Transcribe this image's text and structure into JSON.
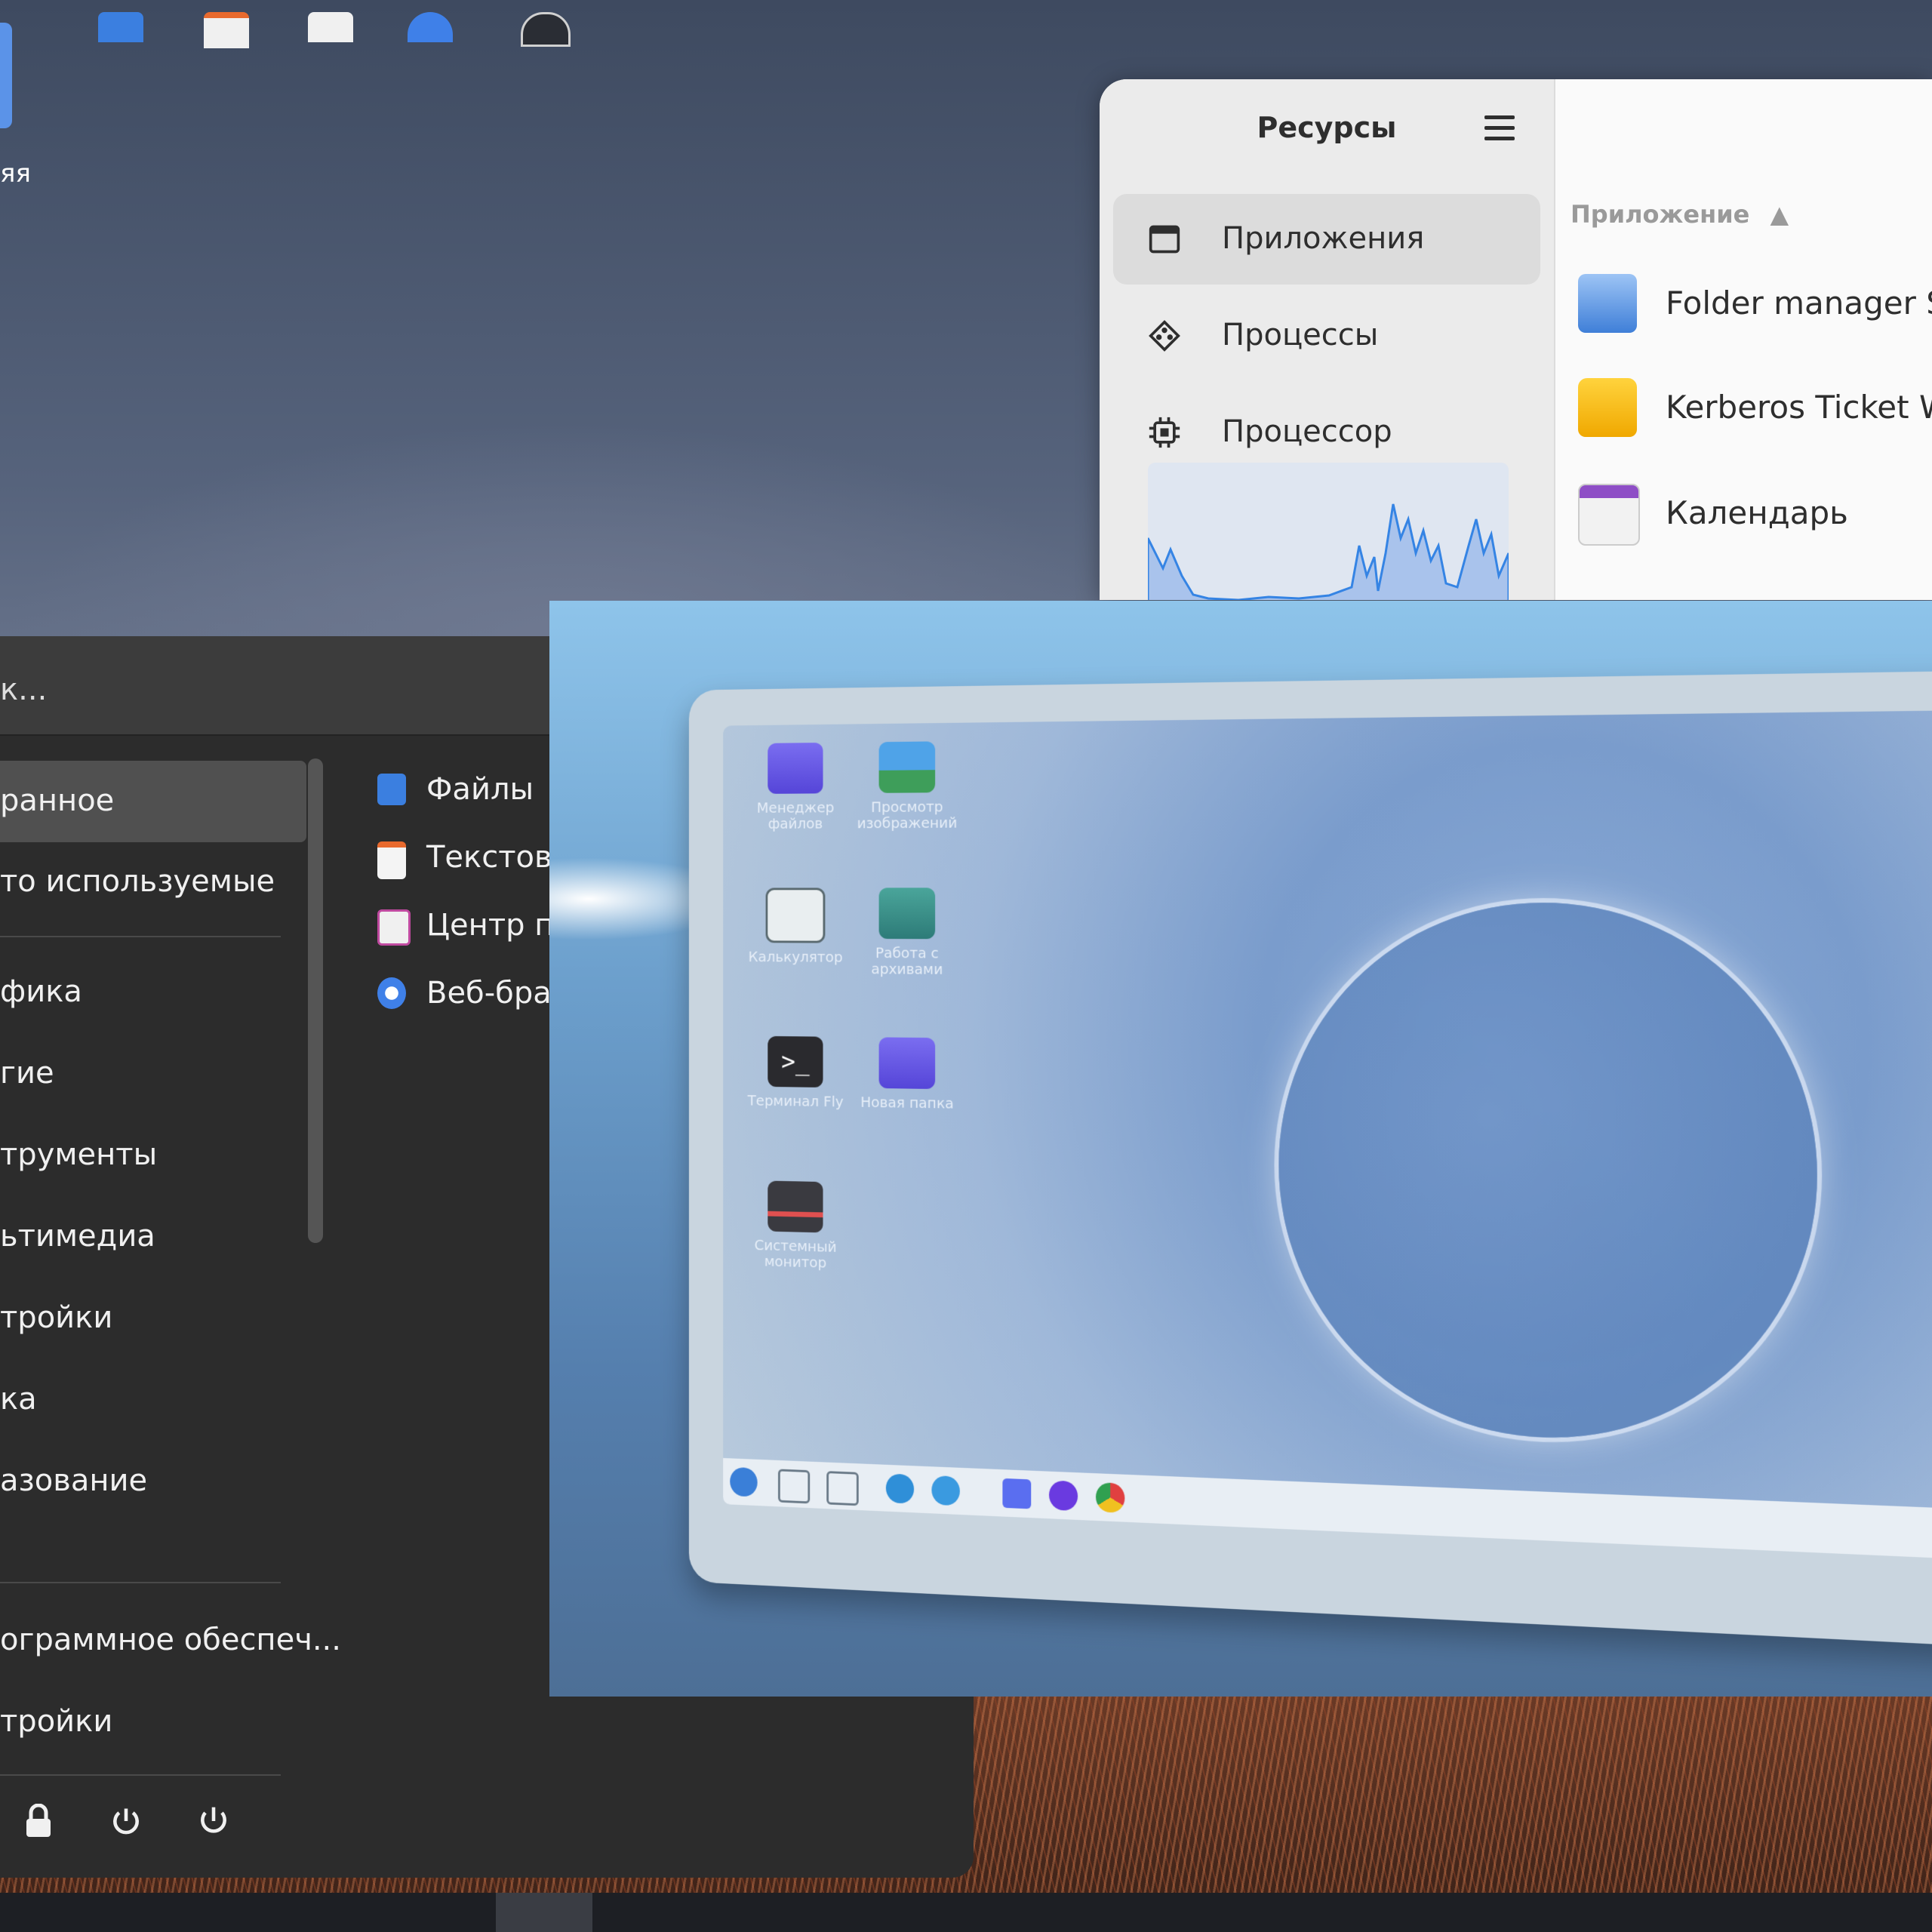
{
  "desktop": {
    "icon_label": "яя"
  },
  "resources": {
    "title": "Ресурсы",
    "nav": [
      {
        "label": "Приложения",
        "icon": "window-icon",
        "selected": true
      },
      {
        "label": "Процессы",
        "icon": "processes-icon",
        "selected": false
      },
      {
        "label": "Процессор",
        "icon": "cpu-icon",
        "selected": false
      }
    ],
    "column_header": "Приложение",
    "apps": [
      {
        "name": "Folder manager Se",
        "icon": "folder-manager-icon"
      },
      {
        "name": "Kerberos Ticket Wa",
        "icon": "lock-icon"
      },
      {
        "name": "Календарь",
        "icon": "calendar-icon"
      }
    ]
  },
  "menu": {
    "search_placeholder": "к...",
    "categories": [
      {
        "label": "ранное",
        "selected": true
      },
      {
        "label": "то используемые",
        "selected": false
      },
      {
        "label": "фика",
        "selected": false
      },
      {
        "label": "гие",
        "selected": false
      },
      {
        "label": "трументы",
        "selected": false
      },
      {
        "label": "ьтимедиа",
        "selected": false
      },
      {
        "label": "тройки",
        "selected": false
      },
      {
        "label": "ка",
        "selected": false
      },
      {
        "label": "азование",
        "selected": false
      },
      {
        "label": "ограммное обеспеч...",
        "selected": false
      },
      {
        "label": "тройки",
        "selected": false
      }
    ],
    "favorites": [
      {
        "label": "Файлы",
        "icon": "files-icon"
      },
      {
        "label": "Текстов",
        "icon": "text-editor-icon"
      },
      {
        "label": "Центр пр",
        "icon": "app-center-icon"
      },
      {
        "label": "Веб-бра",
        "icon": "web-browser-icon"
      }
    ],
    "power": {
      "lock": "lock-icon",
      "restart": "restart-icon",
      "shutdown": "power-icon"
    }
  },
  "preview": {
    "desktop_icons": [
      {
        "label": "Менеджер файлов",
        "icon": "folder-icon"
      },
      {
        "label": "Просмотр изображений",
        "icon": "image-viewer-icon"
      },
      {
        "label": "Калькулятор",
        "icon": "calculator-icon"
      },
      {
        "label": "Работа с архивами",
        "icon": "archive-icon"
      },
      {
        "label": "Терминал Fly",
        "icon": "terminal-icon"
      },
      {
        "label": "Новая папка",
        "icon": "folder-icon"
      },
      {
        "label": "Системный монитор",
        "icon": "system-monitor-icon"
      }
    ]
  },
  "colors": {
    "accent": "#3584e4",
    "menu_bg": "#2c2c2c",
    "resources_bg": "#fafafa"
  }
}
